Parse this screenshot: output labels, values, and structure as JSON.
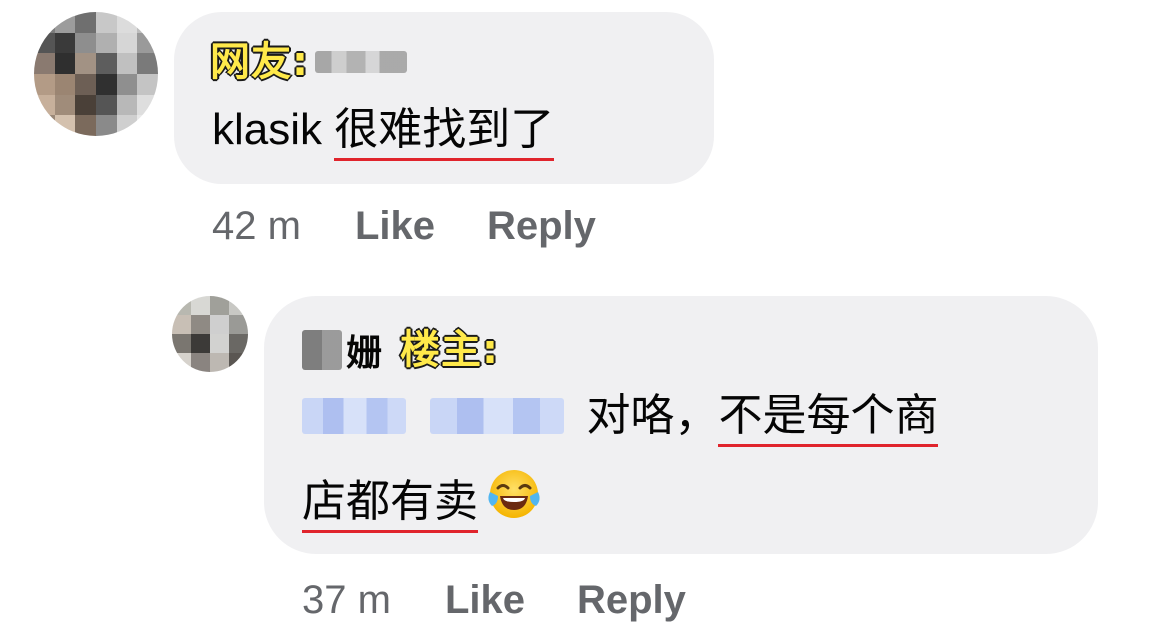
{
  "comments": [
    {
      "author_tag": "网友:",
      "text_latin": "klasik ",
      "text_cjk": "很难找到了",
      "time": "42 m",
      "like_label": "Like",
      "reply_label": "Reply"
    },
    {
      "author_visible_char": "姗",
      "author_tag": "楼主:",
      "text_prefix": "对咯，",
      "text_underlined_1": "不是每个商",
      "text_underlined_2": "店都有卖",
      "emoji": "face-with-tears-of-joy",
      "time": "37 m",
      "like_label": "Like",
      "reply_label": "Reply"
    }
  ],
  "colors": {
    "bubble_background": "#f0f0f2",
    "meta_text": "#65676b",
    "highlight_tag": "#ffe94a",
    "underline": "#e0242c"
  }
}
